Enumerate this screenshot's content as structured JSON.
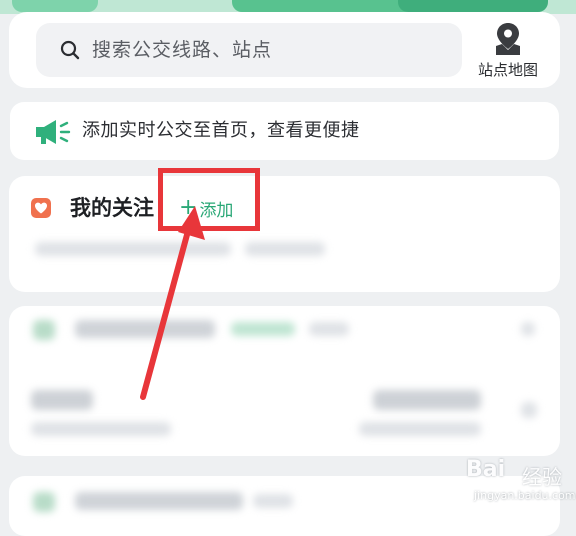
{
  "search": {
    "placeholder": "搜索公交线路、站点",
    "map_label": "站点地图"
  },
  "promo": {
    "text": "添加实时公交至首页，查看更便捷"
  },
  "follow": {
    "title": "我的关注",
    "add_label": "添加",
    "add_plus": "+"
  },
  "watermark": {
    "logo": "Bai",
    "cn": "经验",
    "url": "jingyan.baidu.com"
  },
  "colors": {
    "accent": "#2aa876",
    "highlight": "#e8363a",
    "heart": "#f0714e"
  },
  "icons": [
    "search-icon",
    "map-pin-icon",
    "megaphone-icon",
    "heart-icon",
    "arrow-annotation"
  ]
}
